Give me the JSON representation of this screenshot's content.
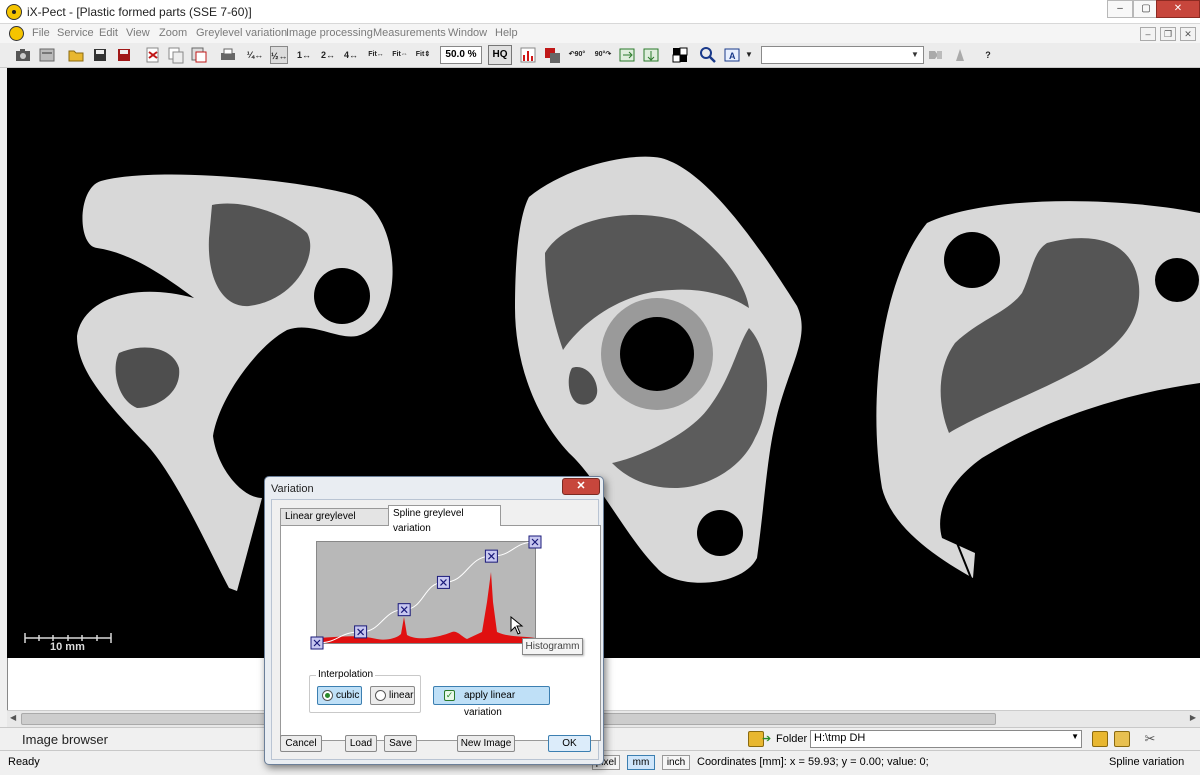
{
  "window": {
    "title": "iX-Pect - [Plastic formed parts (SSE 7-60)]"
  },
  "menubar": {
    "items": [
      "File",
      "Service",
      "Edit",
      "View",
      "Zoom",
      "Greylevel variation",
      "Image processing",
      "Measurements",
      "Window",
      "Help"
    ]
  },
  "toolbar": {
    "zoom_factors": [
      "¼",
      "½",
      "1",
      "2",
      "4",
      "Fit",
      "Fit",
      "Fit"
    ],
    "rotate_labels": [
      "90°",
      "90°"
    ],
    "zoom_value": "50.0 %",
    "hq_label": "HQ",
    "help_label": "?"
  },
  "image": {
    "scalebar_label": "10 mm"
  },
  "image_browser": {
    "label": "Image browser",
    "folder_label": "Folder :",
    "folder_value": "H:\\tmp DH"
  },
  "status": {
    "ready": "Ready",
    "units": [
      "pixel",
      "mm",
      "inch"
    ],
    "active_unit": "mm",
    "coordinates": "Coordinates [mm]:  x = 59.93; y = 0.00; value: 0;",
    "mode": "Spline variation"
  },
  "dialog": {
    "title": "Variation",
    "close_label": "✕",
    "tabs": [
      "Linear greylevel variation",
      "Spline greylevel variation"
    ],
    "active_tab": "Spline greylevel variation",
    "tooltip": "Histogramm",
    "interpolation_label": "Interpolation",
    "interpolation_options": [
      "cubic",
      "linear"
    ],
    "interpolation_selected": "cubic",
    "apply_label": "apply linear variation",
    "buttons": {
      "cancel": "Cancel",
      "load": "Load",
      "save": "Save",
      "new_image": "New Image",
      "ok": "OK"
    },
    "curve_points": [
      [
        0,
        0
      ],
      [
        0.2,
        0.11
      ],
      [
        0.4,
        0.33
      ],
      [
        0.58,
        0.6
      ],
      [
        0.8,
        0.86
      ],
      [
        1.0,
        1.0
      ]
    ]
  },
  "colors": {
    "histogram": "#e01010",
    "curve": "#ffffff",
    "selection": "#bfe0f7"
  }
}
